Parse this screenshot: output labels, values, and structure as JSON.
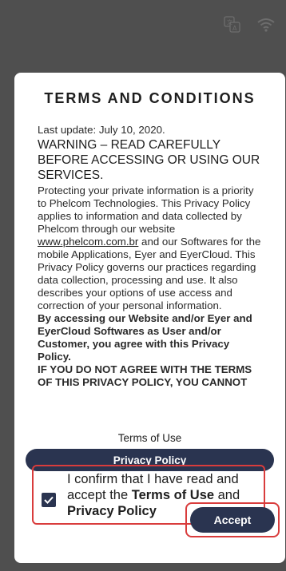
{
  "status_bar": {
    "icons": [
      "translate-icon",
      "wifi-icon"
    ]
  },
  "dialog": {
    "title": "TERMS AND CONDITIONS",
    "last_update": "Last update: July 10, 2020.",
    "warning": "WARNING – READ CAREFULLY BEFORE ACCESSING OR USING OUR SERVICES.",
    "para1_before_link": "Protecting your private information is a priority to Phelcom Technologies. This Privacy Policy applies to information and data collected by Phelcom through our website ",
    "para1_link": "www.phelcom.com.br",
    "para1_after_link": " and our Softwares for the mobile Applications, Eyer and EyerCloud. This Privacy Policy governs our practices regarding data collection, processing and use. It also describes your options of use access and correction of your personal information.",
    "bold_para1": "By accessing our Website and/or Eyer and EyerCloud Softwares as User and/or Customer, you agree with this Privacy Policy.",
    "bold_para2": "IF YOU DO NOT AGREE WITH THE TERMS OF THIS PRIVACY POLICY, YOU CANNOT",
    "terms_of_use": "Terms of Use",
    "privacy_policy_button": "Privacy Policy",
    "confirm": {
      "prefix": "I confirm that I have read and accept the ",
      "terms_bold": "Terms of Use",
      "and": " and ",
      "privacy_bold": "Privacy Policy",
      "checked": true
    },
    "accept_button": "Accept"
  },
  "colors": {
    "primary": "#2a3450",
    "highlight": "#d93c3c",
    "background": "#4f4f4f"
  }
}
